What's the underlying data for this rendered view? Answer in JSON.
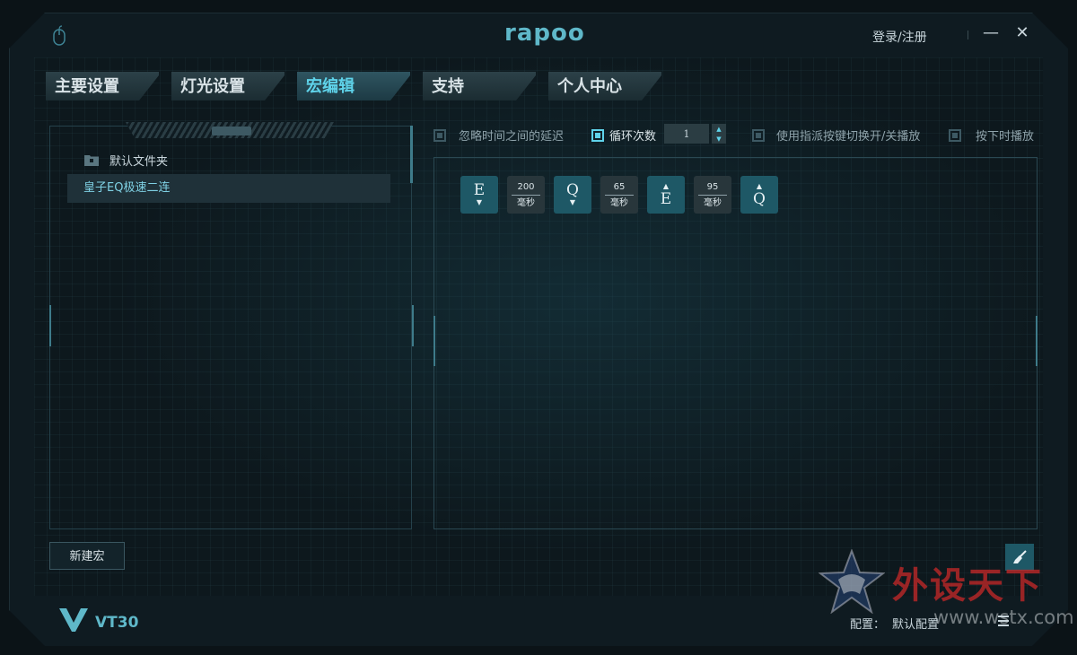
{
  "app": {
    "brand": "rapoo",
    "login_label": "登录/注册",
    "minimize_label": "—",
    "close_label": "✕"
  },
  "tabs": [
    {
      "label": "主要设置",
      "active": false
    },
    {
      "label": "灯光设置",
      "active": false
    },
    {
      "label": "宏编辑",
      "active": true
    },
    {
      "label": "支持",
      "active": false
    },
    {
      "label": "个人中心",
      "active": false
    }
  ],
  "macro_list": {
    "folder_name": "默认文件夹",
    "items": [
      "皇子EQ极速二连"
    ],
    "new_button_label": "新建宏"
  },
  "options": {
    "ignore_delay": {
      "label": "忽略时间之间的延迟",
      "checked": false
    },
    "loop_count": {
      "label": "循环次数",
      "checked": true,
      "value": "1"
    },
    "toggle_play": {
      "label": "使用指派按键切换开/关播放",
      "checked": false
    },
    "hold_play": {
      "label": "按下时播放",
      "checked": false
    }
  },
  "macro_sequence": [
    {
      "type": "key",
      "key": "E",
      "action": "down"
    },
    {
      "type": "delay",
      "ms": "200",
      "unit": "毫秒"
    },
    {
      "type": "key",
      "key": "Q",
      "action": "down"
    },
    {
      "type": "delay",
      "ms": "65",
      "unit": "毫秒"
    },
    {
      "type": "key",
      "key": "E",
      "action": "up"
    },
    {
      "type": "delay",
      "ms": "95",
      "unit": "毫秒"
    },
    {
      "type": "key",
      "key": "Q",
      "action": "up"
    }
  ],
  "footer": {
    "model": "VT30",
    "config_label": "配置：",
    "config_value": "默认配置"
  },
  "watermark": {
    "text": "外设天下",
    "url": "www.wstx.com"
  },
  "colors": {
    "accent": "#5fd3ea",
    "key_bg": "#1e5866",
    "background": "#0d181d"
  }
}
